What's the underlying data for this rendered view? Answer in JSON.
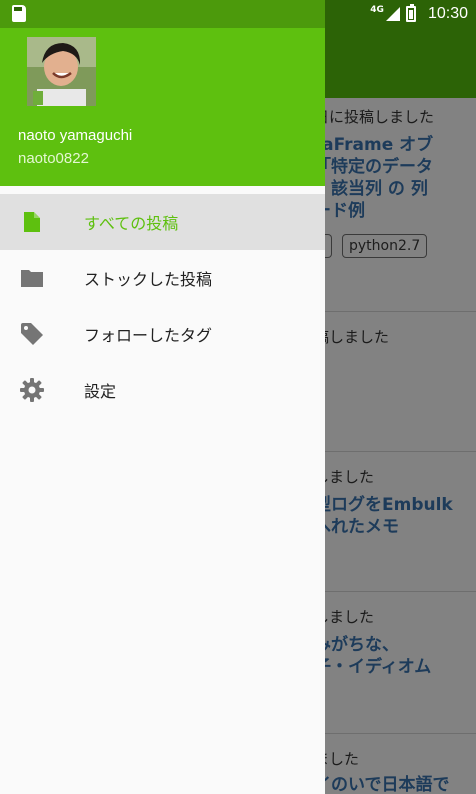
{
  "status_bar": {
    "network": "4G",
    "time": "10:30"
  },
  "drawer": {
    "user": {
      "name": "naoto yamaguchi",
      "id": "naoto0822"
    },
    "menu": [
      {
        "label": "すべての投稿",
        "icon": "document-icon",
        "active": true
      },
      {
        "label": "ストックした投稿",
        "icon": "folder-icon",
        "active": false
      },
      {
        "label": "フォローしたタグ",
        "icon": "tag-icon",
        "active": false
      },
      {
        "label": "設定",
        "icon": "gear-icon",
        "active": false
      }
    ]
  },
  "feed": [
    {
      "meta": "日に投稿しました",
      "title_lines": [
        "taFrame オブ",
        "「特定のデータ",
        "、該当列 の 列",
        "ード例"
      ],
      "tags": [
        "",
        "python2.7"
      ]
    },
    {
      "meta": "稿しました",
      "title_lines": [],
      "tags": []
    },
    {
      "meta": "しました",
      "title_lines": [
        "型ログをEmbulk",
        "へれたメモ"
      ],
      "tags": []
    },
    {
      "meta": "しました",
      "title_lines": [
        "みがちな、",
        "子・イディオム"
      ],
      "tags": []
    },
    {
      "meta": "ました",
      "title_lines": [
        "イのいで日本語で"
      ],
      "tags": []
    }
  ],
  "colors": {
    "accent": "#5ec00f",
    "status_bar": "#2c6306",
    "active_item_bg": "#e0e0e0",
    "icon_gray": "#757575"
  }
}
